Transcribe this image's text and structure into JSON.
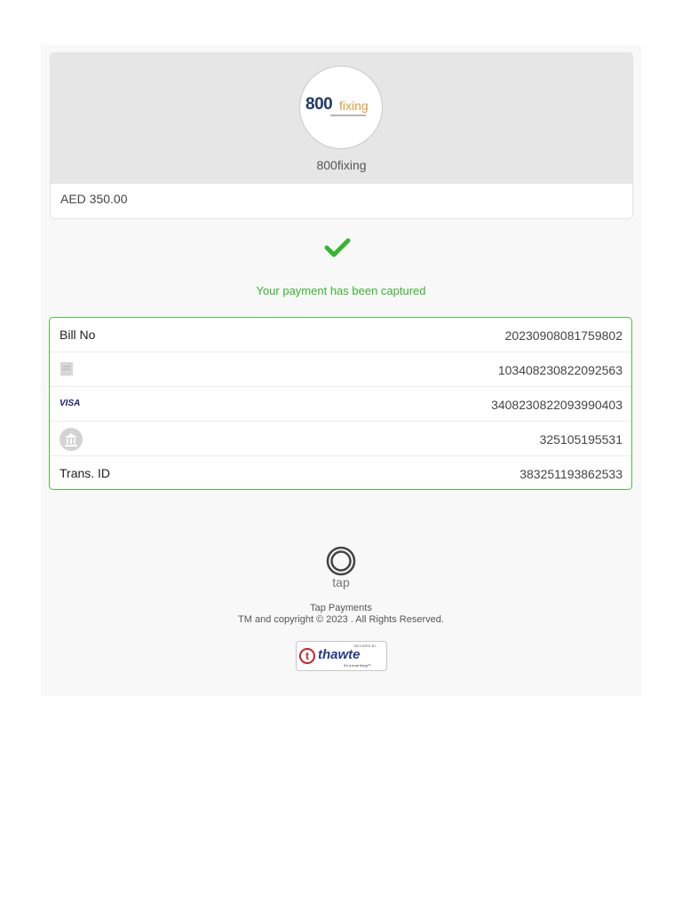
{
  "merchant": {
    "logo_number": "800",
    "logo_word": "fixing",
    "name": "800fixing"
  },
  "amount": "AED 350.00",
  "status": {
    "message": "Your payment has been captured",
    "color": "#35b72d"
  },
  "details": {
    "bill_no_label": "Bill No",
    "bill_no_value": "20230908081759802",
    "receipt_icon": "receipt-icon",
    "receipt_value": "103408230822092563",
    "card_brand": "VISA",
    "card_value": "3408230822093990403",
    "bank_icon": "bank-icon",
    "bank_value": "325105195531",
    "trans_label": "Trans. ID",
    "trans_value": "383251193862533"
  },
  "footer": {
    "tap_word": "tap",
    "company": "Tap Payments",
    "copyright": "TM and copyright © 2023 . All Rights Reserved.",
    "badge_secured": "SECURED BY",
    "badge_brand": "thawte",
    "badge_tagline": "it's a trust thing™"
  }
}
